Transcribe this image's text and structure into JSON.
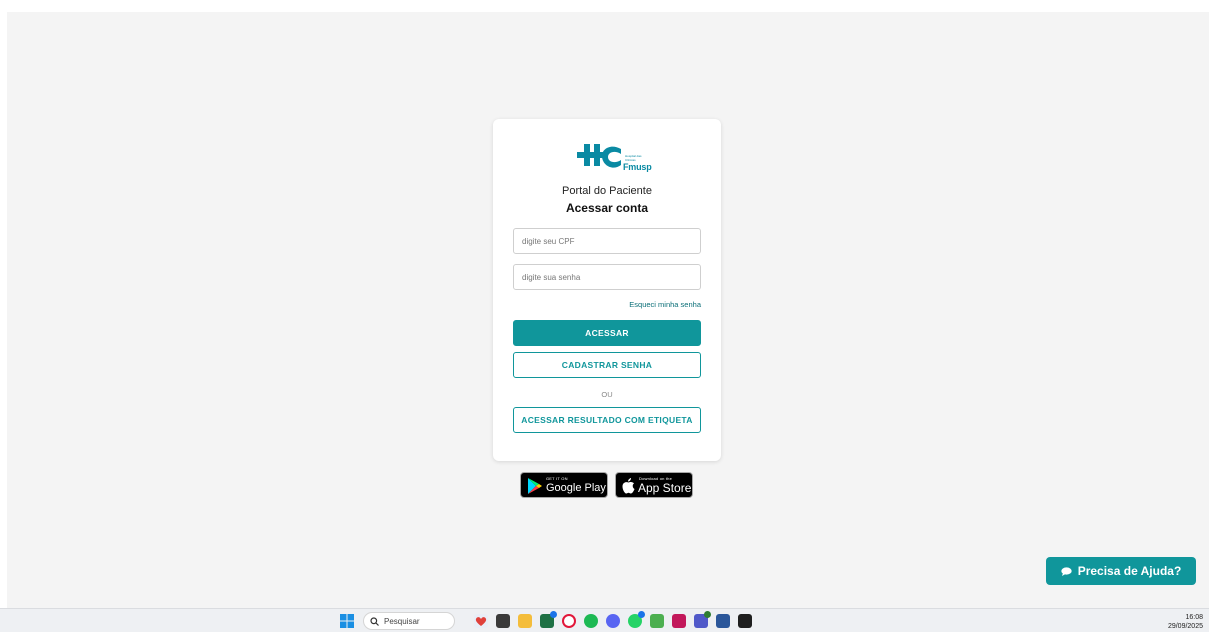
{
  "brand": {
    "logo_text": "Fmusp",
    "logo_small": "Hospital das Clínicas"
  },
  "login": {
    "subtitle": "Portal do Paciente",
    "title": "Acessar conta",
    "cpf_placeholder": "digite seu CPF",
    "password_placeholder": "digite sua senha",
    "forgot_link": "Esqueci minha senha",
    "submit_label": "ACESSAR",
    "register_label": "CADASTRAR SENHA",
    "or_label": "OU",
    "label_result": "ACESSAR RESULTADO COM ETIQUETA"
  },
  "stores": {
    "google": {
      "small": "GET IT ON",
      "big": "Google Play"
    },
    "apple": {
      "small": "Download on the",
      "big": "App Store"
    }
  },
  "help": {
    "label": "Precisa de Ajuda?"
  },
  "taskbar": {
    "search_placeholder": "Pesquisar",
    "time": "16:08",
    "date": "29/09/2025"
  },
  "colors": {
    "accent": "#10969b",
    "logo": "#0a8aa3"
  }
}
